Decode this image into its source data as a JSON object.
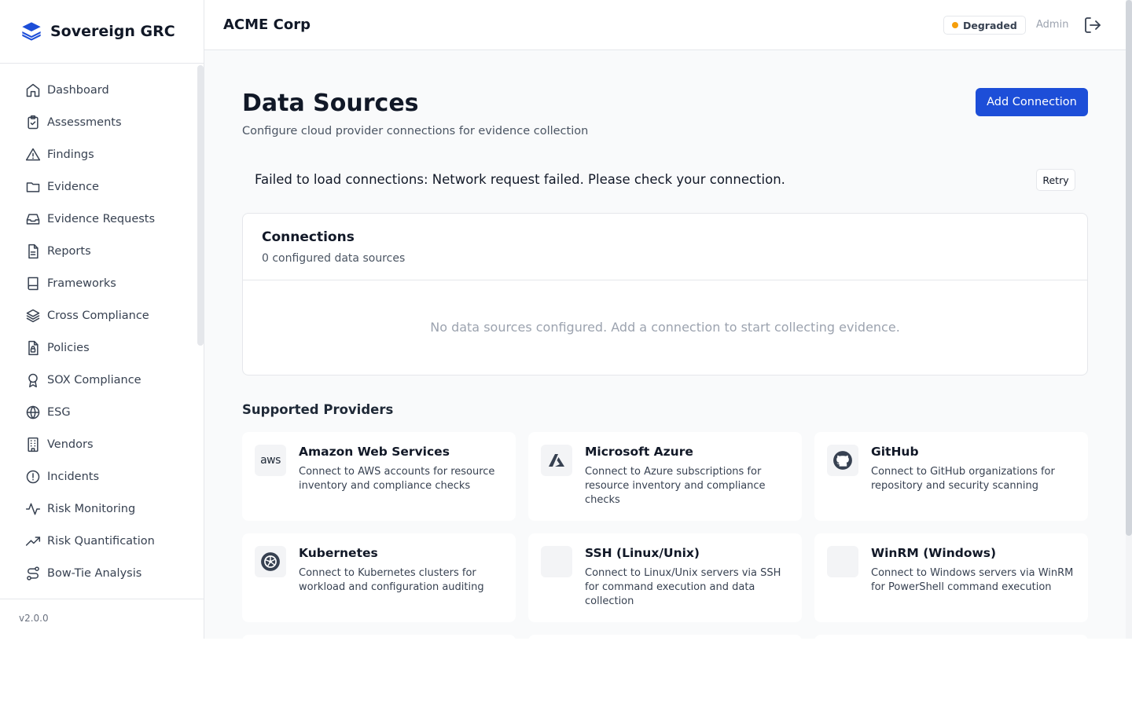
{
  "brand": {
    "name": "Sovereign GRC",
    "version": "v2.0.0"
  },
  "sidebar": {
    "items": [
      {
        "label": "Dashboard",
        "icon": "home-icon"
      },
      {
        "label": "Assessments",
        "icon": "clipboard-check-icon"
      },
      {
        "label": "Findings",
        "icon": "alert-triangle-icon"
      },
      {
        "label": "Evidence",
        "icon": "folder-icon"
      },
      {
        "label": "Evidence Requests",
        "icon": "inbox-icon"
      },
      {
        "label": "Reports",
        "icon": "file-text-icon"
      },
      {
        "label": "Frameworks",
        "icon": "book-icon"
      },
      {
        "label": "Cross Compliance",
        "icon": "layers-icon"
      },
      {
        "label": "Policies",
        "icon": "file-lock-icon"
      },
      {
        "label": "SOX Compliance",
        "icon": "award-icon"
      },
      {
        "label": "ESG",
        "icon": "globe-icon"
      },
      {
        "label": "Vendors",
        "icon": "building-icon"
      },
      {
        "label": "Incidents",
        "icon": "alert-circle-icon"
      },
      {
        "label": "Risk Monitoring",
        "icon": "activity-icon"
      },
      {
        "label": "Risk Quantification",
        "icon": "trending-up-icon"
      },
      {
        "label": "Bow-Tie Analysis",
        "icon": "route-icon"
      }
    ]
  },
  "header": {
    "org": "ACME Corp",
    "status": "Degraded",
    "status_color": "#f59e0b",
    "user_role": "Admin",
    "logout_icon": "logout-icon"
  },
  "main": {
    "title": "Data Sources",
    "subtitle": "Configure cloud provider connections for evidence collection",
    "add_button": "Add Connection",
    "error": "Failed to load connections: Network request failed. Please check your connection.",
    "retry": "Retry",
    "connections": {
      "title": "Connections",
      "count": "0 configured data sources",
      "empty": "No data sources configured. Add a connection to start collecting evidence."
    },
    "providers_title": "Supported Providers",
    "providers": [
      {
        "name": "Amazon Web Services",
        "desc": "Connect to AWS accounts for resource inventory and compliance checks",
        "icon": "aws-icon",
        "icon_text": "aws"
      },
      {
        "name": "Microsoft Azure",
        "desc": "Connect to Azure subscriptions for resource inventory and compliance checks",
        "icon": "azure-icon"
      },
      {
        "name": "GitHub",
        "desc": "Connect to GitHub organizations for repository and security scanning",
        "icon": "github-icon"
      },
      {
        "name": "Kubernetes",
        "desc": "Connect to Kubernetes clusters for workload and configuration auditing",
        "icon": "kubernetes-icon"
      },
      {
        "name": "SSH (Linux/Unix)",
        "desc": "Connect to Linux/Unix servers via SSH for command execution and data collection",
        "icon": "ssh-icon"
      },
      {
        "name": "WinRM (Windows)",
        "desc": "Connect to Windows servers via WinRM for PowerShell command execution",
        "icon": "winrm-icon"
      }
    ]
  },
  "colors": {
    "accent": "#1d4ed8",
    "warning": "#f59e0b"
  }
}
